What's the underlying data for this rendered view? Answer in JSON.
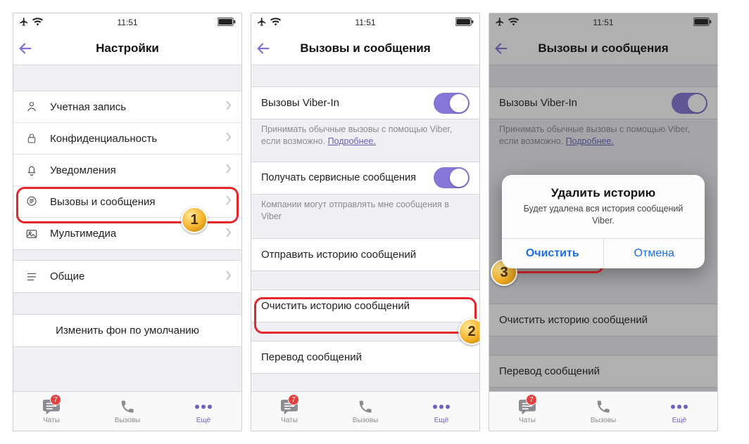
{
  "accent": "#6f61c0",
  "statusbar": {
    "time": "11:51"
  },
  "screen1": {
    "title": "Настройки",
    "items": [
      {
        "label": "Учетная запись"
      },
      {
        "label": "Конфиденциальность"
      },
      {
        "label": "Уведомления"
      },
      {
        "label": "Вызовы и сообщения"
      },
      {
        "label": "Мультимедиа"
      },
      {
        "label": "Общие"
      }
    ],
    "wallpaper_label": "Изменить фон по умолчанию"
  },
  "screen2": {
    "title": "Вызовы и сообщения",
    "viber_in_label": "Вызовы Viber-In",
    "viber_in_caption_pre": "Принимать обычные вызовы с помощью Viber, если возможно. ",
    "viber_in_caption_link": "Подробнее.",
    "service_msg_label": "Получать сервисные сообщения",
    "service_msg_caption": "Компании могут отправлять мне сообщения в Viber",
    "send_history_label": "Отправить историю сообщений",
    "clear_history_label": "Очистить историю сообщений",
    "translate_label": "Перевод сообщений"
  },
  "screen3": {
    "title": "Вызовы и сообщения",
    "viber_in_label": "Вызовы Viber-In",
    "viber_in_caption_pre": "Принимать обычные вызовы с помощью Viber, если возможно. ",
    "viber_in_caption_link": "Подробнее.",
    "clear_history_label": "Очистить историю сообщений",
    "translate_label": "Перевод сообщений",
    "alert": {
      "title": "Удалить историю",
      "message": "Будет удалена вся история сообщений Viber.",
      "confirm": "Очистить",
      "cancel": "Отмена"
    }
  },
  "tabs": {
    "chats": "Чаты",
    "calls": "Вызовы",
    "more": "Ещё",
    "badge": "7"
  },
  "steps": {
    "one": "1",
    "two": "2",
    "three": "3"
  }
}
